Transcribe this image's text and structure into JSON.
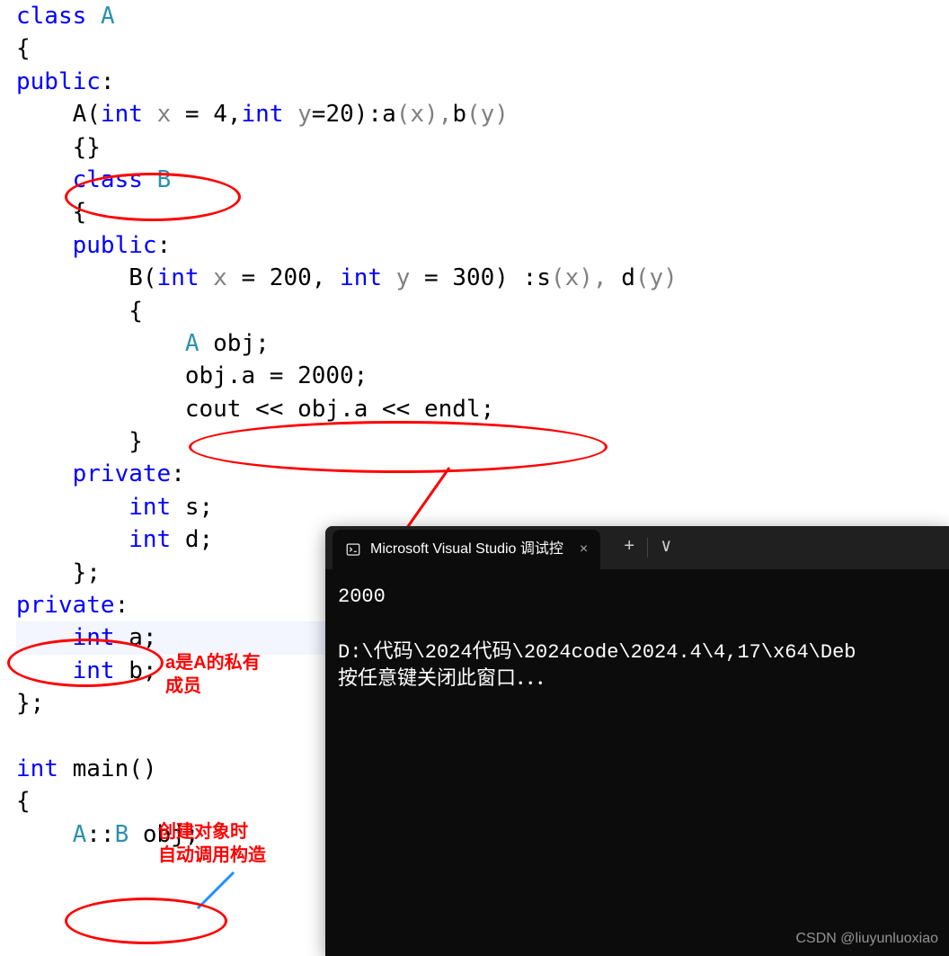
{
  "code": {
    "l1_class": "class",
    "l1_A": "A",
    "l2_brace": "{",
    "l3_public": "public",
    "l3_colon": ":",
    "l4_ctorA": "A",
    "l4_open": "(",
    "l4_int1": "int",
    "l4_x": "x",
    "l4_eq1": " = ",
    "l4_4": "4",
    "l4_comma": ",",
    "l4_int2": "int",
    "l4_y": "y",
    "l4_eq2": "=",
    "l4_20": "20",
    "l4_close": ")",
    "l4_colon": ":",
    "l4_a": "a",
    "l4_ax": "(x),",
    "l4_b": "b",
    "l4_by": "(y)",
    "l5_braces": "{}",
    "l6_class": "class",
    "l6_B": "B",
    "l7_brace": "{",
    "l8_public": "public",
    "l8_colon": ":",
    "l9_B": "B",
    "l9_open": "(",
    "l9_int1": "int",
    "l9_x": "x",
    "l9_eq1": " = ",
    "l9_200": "200",
    "l9_comma": ", ",
    "l9_int2": "int",
    "l9_y": "y",
    "l9_eq2": " = ",
    "l9_300": "300",
    "l9_close": ") :",
    "l9_s": "s",
    "l9_sx": "(x), ",
    "l9_d": "d",
    "l9_dy": "(y)",
    "l10_brace": "{",
    "l11_A": "A",
    "l11_obj": " obj;",
    "l12_code": "obj.a = 2000;",
    "l13_cout": "cout",
    "l13_op1": " << ",
    "l13_obj": "obj",
    "l13_dot": ".",
    "l13_a": "a",
    "l13_op2": " << ",
    "l13_endl": "endl",
    "l13_semi": ";",
    "l14_brace": "}",
    "l15_private": "private",
    "l15_colon": ":",
    "l16_int": "int",
    "l16_s": " s;",
    "l17_int": "int",
    "l17_d": " d;",
    "l18_end": "};",
    "l19_private": "private",
    "l19_colon": ":",
    "l20_int": "int",
    "l20_a": " a;",
    "l21_int": "int",
    "l21_b": " b;",
    "l22_end": "};",
    "l24_int": "int",
    "l24_main": " main()",
    "l25_brace": "{",
    "l26_A": "A",
    "l26_scope": "::",
    "l26_B": "B",
    "l26_obj": " obj;"
  },
  "annotations": {
    "a_private_note_l1": "a是A的私有",
    "a_private_note_l2": "成员",
    "main_note_l1": "创建对象时",
    "main_note_l2": "自动调用构造"
  },
  "console": {
    "tab_title": "Microsoft Visual Studio 调试控",
    "output_value": "2000",
    "path_line": "D:\\代码\\2024代码\\2024code\\2024.4\\4,17\\x64\\Deb",
    "close_prompt": "按任意键关闭此窗口．．．",
    "new_tab": "+",
    "dropdown": "∨",
    "close_tab": "×"
  },
  "watermark": "CSDN @liuyunluoxiao"
}
